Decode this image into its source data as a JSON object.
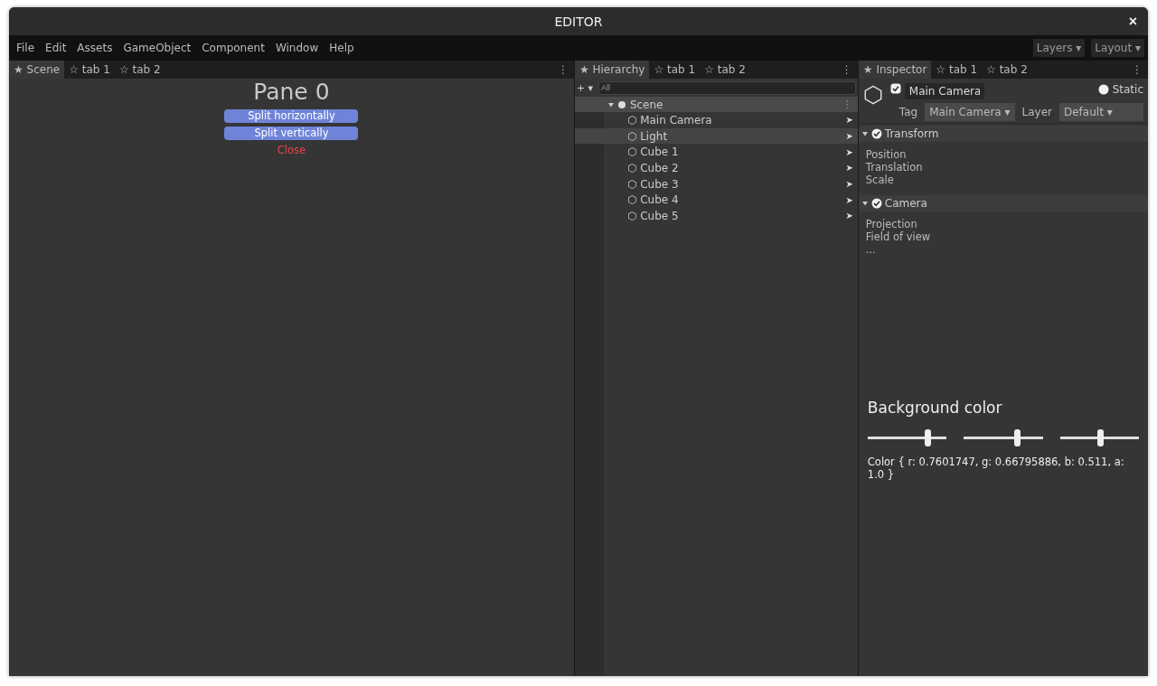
{
  "window": {
    "title": "EDITOR",
    "close": "×"
  },
  "menu": [
    "File",
    "Edit",
    "Assets",
    "GameObject",
    "Component",
    "Window",
    "Help"
  ],
  "menu_right": [
    "Layers ▾",
    "Layout ▾"
  ],
  "panes": [
    {
      "kind": "scene",
      "tabs": [
        {
          "label": "★ Scene",
          "selected": true
        },
        {
          "label": "☆ tab 1",
          "selected": false
        },
        {
          "label": "☆ tab 2",
          "selected": false
        }
      ],
      "more": "⋮",
      "title": "Pane 0",
      "buttons": [
        "Split horizontally",
        "Split vertically"
      ],
      "close": "Close"
    },
    {
      "kind": "hierarchy",
      "tabs": [
        {
          "label": "★ Hierarchy",
          "selected": true
        },
        {
          "label": "☆ tab 1",
          "selected": false
        },
        {
          "label": "☆ tab 2",
          "selected": false
        }
      ],
      "more": "⋮",
      "add": "+ ▾",
      "search": {
        "placeholder": "All"
      },
      "tree": {
        "label": "Scene",
        "expanded": true,
        "more": "⋮",
        "children": [
          {
            "label": "⬡ Main Camera",
            "selected": false,
            "go": "➤"
          },
          {
            "label": "⬡ Light",
            "selected": true,
            "go": "➤"
          },
          {
            "label": "⬡ Cube 1",
            "selected": false,
            "go": "➤"
          },
          {
            "label": "⬡ Cube 2",
            "selected": false,
            "go": "➤"
          },
          {
            "label": "⬡ Cube 3",
            "selected": false,
            "go": "➤"
          },
          {
            "label": "⬡ Cube 4",
            "selected": false,
            "go": "➤"
          },
          {
            "label": "⬡ Cube 5",
            "selected": false,
            "go": "➤"
          }
        ]
      }
    },
    {
      "kind": "inspector",
      "tabs": [
        {
          "label": "★ Inspector",
          "selected": true
        },
        {
          "label": "☆ tab 1",
          "selected": false
        },
        {
          "label": "☆ tab 2",
          "selected": false
        }
      ],
      "more": "⋮",
      "object": {
        "active": true,
        "name": "Main Camera",
        "static": {
          "label": "Static",
          "checked": false
        },
        "tag_label": "Tag",
        "tag": "Main Camera ▾",
        "layer_label": "Layer",
        "layer": "Default ▾"
      },
      "components": [
        {
          "name": "Transform",
          "expanded": true,
          "enabled": true,
          "fields": [
            "Position",
            "Translation",
            "Scale"
          ]
        },
        {
          "name": "Camera",
          "expanded": true,
          "enabled": true,
          "fields": [
            "Projection",
            "Field of view",
            "..."
          ]
        }
      ],
      "color_title": "Background color",
      "sliders": [
        {
          "level": 0.76
        },
        {
          "level": 0.668
        },
        {
          "level": 0.511
        }
      ],
      "color_text": "Color { r: 0.7601747, g: 0.66795886, b: 0.511, a: 1.0 }"
    }
  ]
}
